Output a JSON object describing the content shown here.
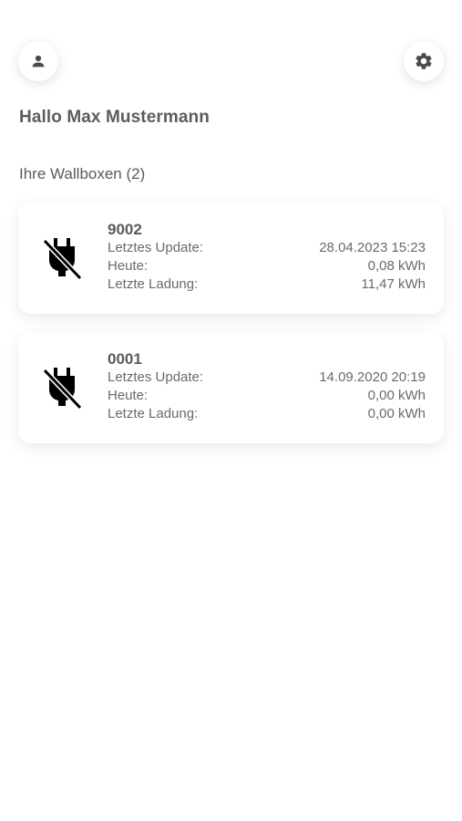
{
  "header": {
    "profile_icon": "person-icon",
    "settings_icon": "gear-icon"
  },
  "greeting": "Hallo Max Mustermann",
  "section_title": "Ihre Wallboxen (2)",
  "wallboxes": [
    {
      "id": "9002",
      "icon": "power-off-plug-icon",
      "last_update_label": "Letztes Update:",
      "last_update_value": "28.04.2023 15:23",
      "today_label": "Heute:",
      "today_value": "0,08 kWh",
      "last_charge_label": "Letzte Ladung:",
      "last_charge_value": "11,47 kWh"
    },
    {
      "id": "0001",
      "icon": "power-off-plug-icon",
      "last_update_label": "Letztes Update:",
      "last_update_value": "14.09.2020 20:19",
      "today_label": "Heute:",
      "today_value": "0,00 kWh",
      "last_charge_label": "Letzte Ladung:",
      "last_charge_value": "0,00 kWh"
    }
  ],
  "colors": {
    "text": "#5a5a5a",
    "icon": "#000000",
    "background": "#ffffff"
  }
}
